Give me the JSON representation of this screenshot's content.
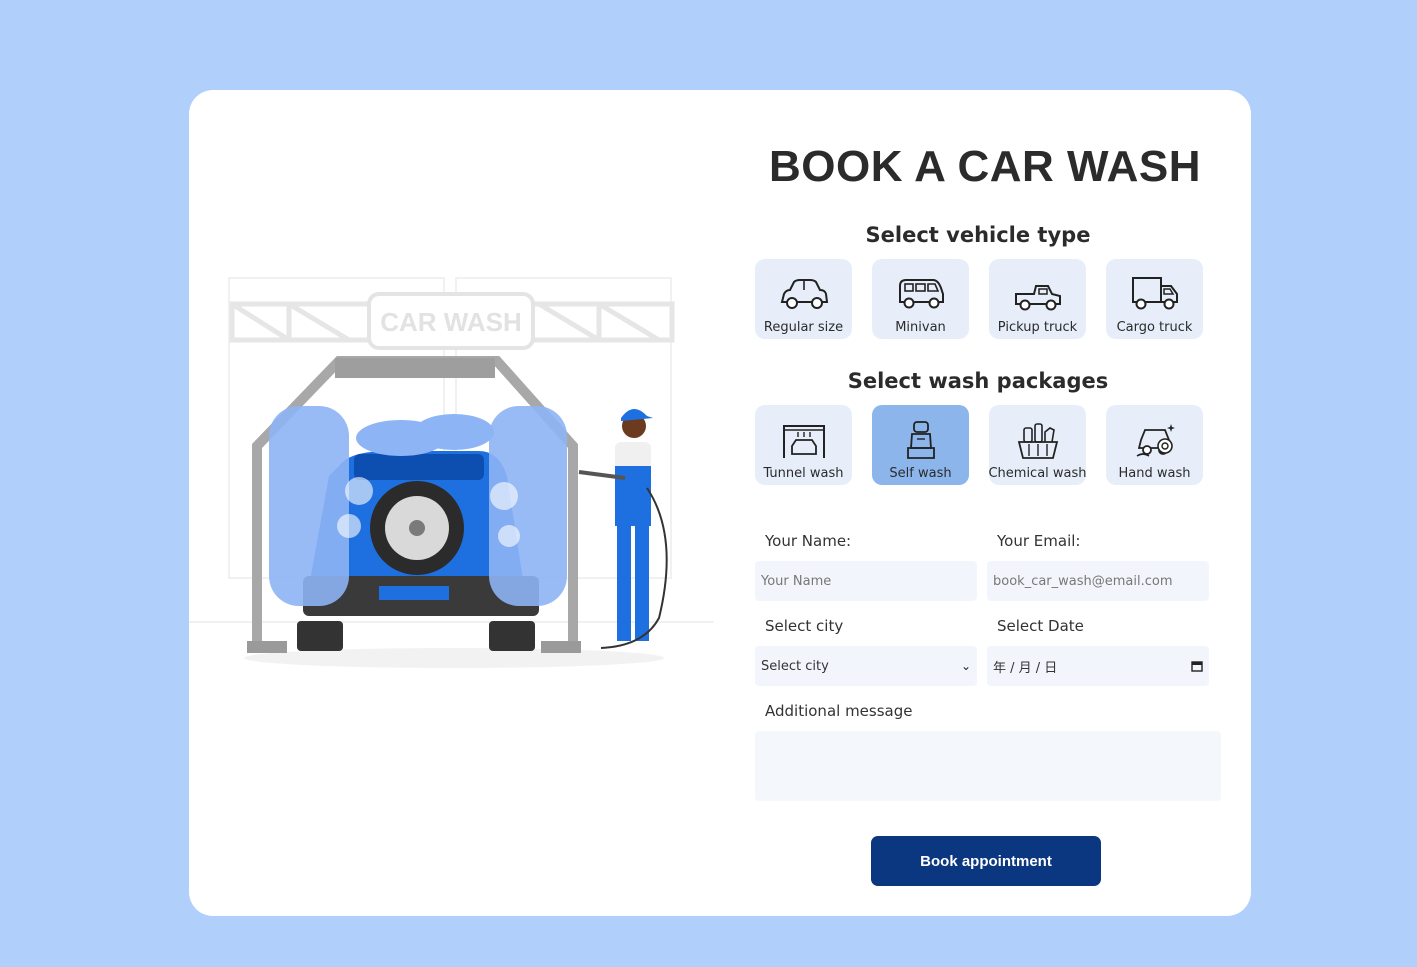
{
  "title": "BOOK A CAR WASH",
  "illustration": {
    "sign_text": "CAR WASH"
  },
  "vehicle_section": {
    "title": "Select vehicle type",
    "options": [
      {
        "label": "Regular size",
        "icon": "car-icon"
      },
      {
        "label": "Minivan",
        "icon": "minivan-icon"
      },
      {
        "label": "Pickup truck",
        "icon": "pickup-truck-icon"
      },
      {
        "label": "Cargo truck",
        "icon": "cargo-truck-icon"
      }
    ]
  },
  "package_section": {
    "title": "Select wash packages",
    "selected": "Self wash",
    "options": [
      {
        "label": "Tunnel wash",
        "icon": "tunnel-wash-icon"
      },
      {
        "label": "Self wash",
        "icon": "car-seat-icon"
      },
      {
        "label": "Chemical wash",
        "icon": "chemical-basket-icon"
      },
      {
        "label": "Hand wash",
        "icon": "hand-wash-icon"
      }
    ]
  },
  "form": {
    "name_label": "Your Name:",
    "name_placeholder": "Your Name",
    "email_label": "Your Email:",
    "email_placeholder": "book_car_wash@email.com",
    "city_label": "Select city",
    "city_value": "Select city",
    "date_label": "Select Date",
    "date_value": "年 / 月 / 日",
    "message_label": "Additional message",
    "message_value": ""
  },
  "book_button_label": "Book appointment",
  "colors": {
    "page_background": "#b0cffb",
    "tile_background": "#e7eef9",
    "tile_selected": "#8cb5ec",
    "button": "#0b3680",
    "car_blue": "#1e6fe0"
  }
}
